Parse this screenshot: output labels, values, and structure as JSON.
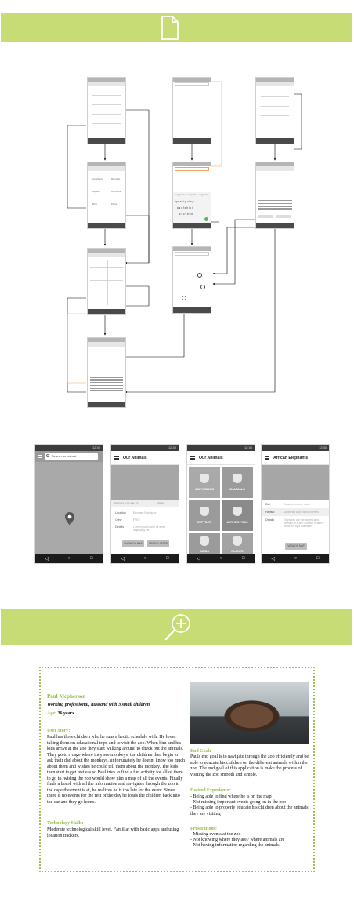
{
  "header_icons": {
    "top": "document-icon",
    "bottom": "magnifier-plus-icon",
    "accent": "#c8dc76"
  },
  "wireframes": {
    "grid_labels": [
      "Amphibians",
      "Mammals",
      "Reptiles",
      "Arthropods",
      "Birds",
      "Plants"
    ],
    "keyboard_suggestions": [
      "suggestion",
      "suggestion",
      "suggestion"
    ],
    "keyboard_row1": "q w e r t y u i o p",
    "keyboard_row2": "a s d f g h j k l",
    "keyboard_row3": "z x c v b n m"
  },
  "mockups": {
    "status_time": "12:30",
    "search": {
      "placeholder": "Search an animal"
    },
    "our_animals_detail": {
      "title": "Our Animals",
      "time": "FRIDAY 3:00 AM - 5",
      "tag": "APRIL",
      "rows": [
        {
          "label": "Location",
          "value": "Elephant Enclosure"
        },
        {
          "label": "Crew",
          "value": "FREE"
        },
        {
          "label": "Details",
          "value": "Lorem ipsum dolor sit amet adipiscing elit"
        }
      ],
      "buttons": [
        "SHOW ON MAP",
        "REMIND LATER"
      ]
    },
    "our_animals_grid": {
      "title": "Our Animals",
      "cells": [
        "AMPHIBIANS",
        "MAMMALS",
        "REPTILES",
        "ARTHROPODS",
        "BIRDS",
        "PLANTS"
      ]
    },
    "elephants": {
      "title": "African Elephants",
      "rows": [
        {
          "label": "Diet",
          "value": "Grasses, leaves, roots"
        },
        {
          "label": "Habitat",
          "value": "Savannas and tropical forests"
        },
        {
          "label": "Details",
          "value": "Elephants are the largest land animals on Earth and live in family herds led by a matriarch."
        }
      ],
      "button": "VIEW ON MAP"
    },
    "nav": [
      "◁",
      "○",
      "□"
    ]
  },
  "persona": {
    "name": "Paul Mcpherson",
    "subtitle": "Working professional, husband with 3 small children",
    "age_label": "Age:",
    "age_value": "36 years",
    "user_story_title": "User Story:",
    "user_story": "Paul has three children who he runs a hectic schedule with. He loves taking them on educational trips and to visit the zoo. When him and his kids arrive at the zoo they start walking around to check out the animals. They go to a cage where they see monkeys, the children then begin to ask their dad about the monkeys, unfortunately he doesnt know too much about them and wishes he could tell them about the monkey. The kids then start to get restless so Paul tries to find a fun activity for all of them to go to, wising the zoo would show him a map of all the events. Finally finds a board with all the information and navigates through the zoo to the cage the event is at, he realizes he is too late for the event. Since there is no events for the rest of the day he loads the children back into the car and they go home.",
    "tech_title": "Technology Skills:",
    "tech": "Moderate technological skill level. Familiar with basic apps and using location trackers.",
    "end_goal_title": "End Goal:",
    "end_goal": "Pauls end goal is to navigate through the zoo efficiently and be able to educate his children on the different animals within the zoo. The end goal of this application is make the process of visiting the zoo smooth and simple.",
    "desired_title": "Desired Experience:",
    "desired": [
      "- Being able to find where he is on the map",
      "- Not missing important events going on in the zoo",
      "- Being able to properly educate his children about the animals they are visiting"
    ],
    "frustrations_title": "Frustrations:",
    "frustrations": [
      "- Missing events at the zoo",
      "- Not knowing where they are / where animals are",
      "- Not having information regarding the animals"
    ]
  }
}
